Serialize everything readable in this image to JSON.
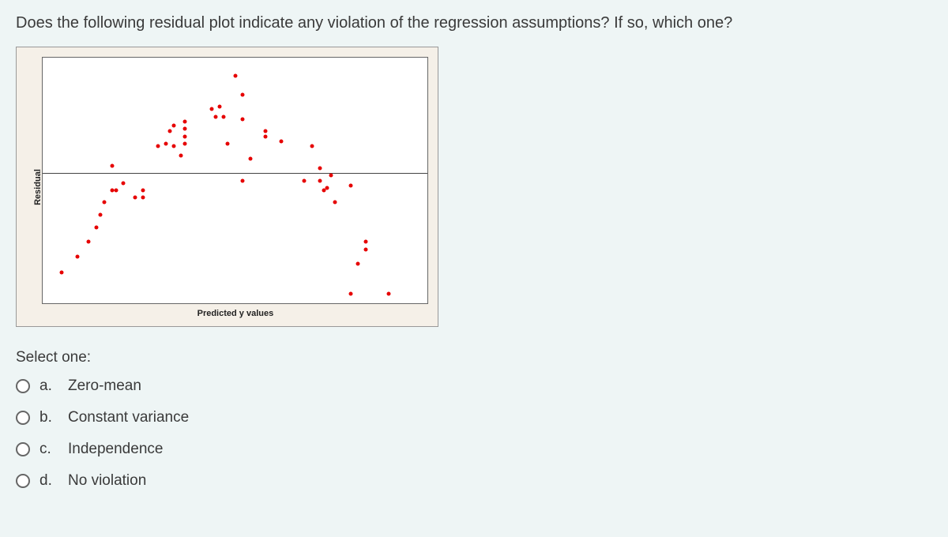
{
  "question": "Does the following residual plot indicate any violation of the regression assumptions?  If so, which one?",
  "chart_data": {
    "type": "scatter",
    "title": "",
    "xlabel": "Predicted y values",
    "ylabel": "Residual",
    "zero_line_y": 0,
    "points": [
      {
        "x": 5,
        "y": -75
      },
      {
        "x": 9,
        "y": -62
      },
      {
        "x": 12,
        "y": -50
      },
      {
        "x": 14,
        "y": -38
      },
      {
        "x": 15,
        "y": -28
      },
      {
        "x": 16,
        "y": -18
      },
      {
        "x": 18,
        "y": 12
      },
      {
        "x": 18,
        "y": -8
      },
      {
        "x": 19,
        "y": -8
      },
      {
        "x": 21,
        "y": -2
      },
      {
        "x": 24,
        "y": -14
      },
      {
        "x": 26,
        "y": -14
      },
      {
        "x": 26,
        "y": -8
      },
      {
        "x": 30,
        "y": 28
      },
      {
        "x": 32,
        "y": 30
      },
      {
        "x": 33,
        "y": 40
      },
      {
        "x": 34,
        "y": 28
      },
      {
        "x": 34,
        "y": 45
      },
      {
        "x": 36,
        "y": 20
      },
      {
        "x": 37,
        "y": 48
      },
      {
        "x": 37,
        "y": 42
      },
      {
        "x": 37,
        "y": 36
      },
      {
        "x": 37,
        "y": 30
      },
      {
        "x": 44,
        "y": 58
      },
      {
        "x": 45,
        "y": 52
      },
      {
        "x": 46,
        "y": 60
      },
      {
        "x": 47,
        "y": 52
      },
      {
        "x": 48,
        "y": 30
      },
      {
        "x": 50,
        "y": 85
      },
      {
        "x": 52,
        "y": 70
      },
      {
        "x": 52,
        "y": 50
      },
      {
        "x": 52,
        "y": 0
      },
      {
        "x": 54,
        "y": 18
      },
      {
        "x": 58,
        "y": 40
      },
      {
        "x": 58,
        "y": 36
      },
      {
        "x": 62,
        "y": 32
      },
      {
        "x": 68,
        "y": 0
      },
      {
        "x": 70,
        "y": 28
      },
      {
        "x": 72,
        "y": 10
      },
      {
        "x": 72,
        "y": 0
      },
      {
        "x": 73,
        "y": -8
      },
      {
        "x": 74,
        "y": -6
      },
      {
        "x": 75,
        "y": 4
      },
      {
        "x": 76,
        "y": -18
      },
      {
        "x": 80,
        "y": -4
      },
      {
        "x": 84,
        "y": -50
      },
      {
        "x": 84,
        "y": -56
      },
      {
        "x": 82,
        "y": -68
      },
      {
        "x": 80,
        "y": -92
      },
      {
        "x": 90,
        "y": -92
      }
    ],
    "xlim": [
      0,
      100
    ],
    "ylim": [
      -100,
      100
    ]
  },
  "answers": {
    "prompt": "Select one:",
    "options": [
      {
        "letter": "a.",
        "text": "Zero-mean"
      },
      {
        "letter": "b.",
        "text": "Constant variance"
      },
      {
        "letter": "c.",
        "text": "Independence"
      },
      {
        "letter": "d.",
        "text": "No violation"
      }
    ]
  }
}
